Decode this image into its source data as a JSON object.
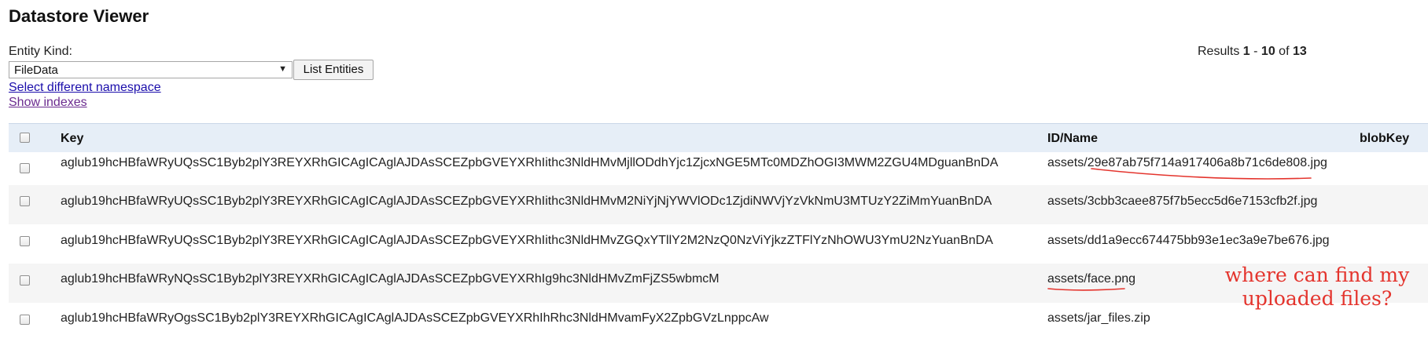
{
  "page": {
    "title": "Datastore Viewer"
  },
  "form": {
    "entity_kind_label": "Entity Kind:",
    "entity_kind_selected": "FileData",
    "list_button_label": "List Entities",
    "select_namespace_link": "Select different namespace",
    "show_indexes_link": "Show indexes"
  },
  "results": {
    "prefix": "Results ",
    "start": "1",
    "sep": " - ",
    "end": "10",
    "of": " of ",
    "total": "13"
  },
  "table": {
    "headers": {
      "key": "Key",
      "id_name": "ID/Name",
      "blob_key": "blobKey"
    },
    "rows": [
      {
        "key": "aglub19hcHBfaWRyUQsSC1Byb2plY3REYXRhGICAgICAglAJDAsSCEZpbGVEYXRhIithc3NldHMvMjllODdhYjc1ZjcxNGE5MTc0MDZhOGI3MWM2ZGU4MDguanBnDA",
        "id_name": "assets/29e87ab75f714a917406a8b71c6de808.jpg",
        "blob_key": ""
      },
      {
        "key": "aglub19hcHBfaWRyUQsSC1Byb2plY3REYXRhGICAgICAglAJDAsSCEZpbGVEYXRhIithc3NldHMvM2NiYjNjYWVlODc1ZjdiNWVjYzVkNmU3MTUzY2ZiMmYuanBnDA",
        "id_name": "assets/3cbb3caee875f7b5ecc5d6e7153cfb2f.jpg",
        "blob_key": ""
      },
      {
        "key": "aglub19hcHBfaWRyUQsSC1Byb2plY3REYXRhGICAgICAglAJDAsSCEZpbGVEYXRhIithc3NldHMvZGQxYTllY2M2NzQ0NzViYjkzZTFlYzNhOWU3YmU2NzYuanBnDA",
        "id_name": "assets/dd1a9ecc674475bb93e1ec3a9e7be676.jpg",
        "blob_key": ""
      },
      {
        "key": "aglub19hcHBfaWRyNQsSC1Byb2plY3REYXRhGICAgICAglAJDAsSCEZpbGVEYXRhIg9hc3NldHMvZmFjZS5wbmcM",
        "id_name": "assets/face.png",
        "blob_key": ""
      },
      {
        "key": "aglub19hcHBfaWRyOgsSC1Byb2plY3REYXRhGICAgICAglAJDAsSCEZpbGVEYXRhIhRhc3NldHMvamFyX2ZpbGVzLnppcAw",
        "id_name": "assets/jar_files.zip",
        "blob_key": ""
      }
    ]
  },
  "annotation": {
    "line1": "where can find my",
    "line2": "uploaded files?",
    "color": "#e4342d"
  }
}
